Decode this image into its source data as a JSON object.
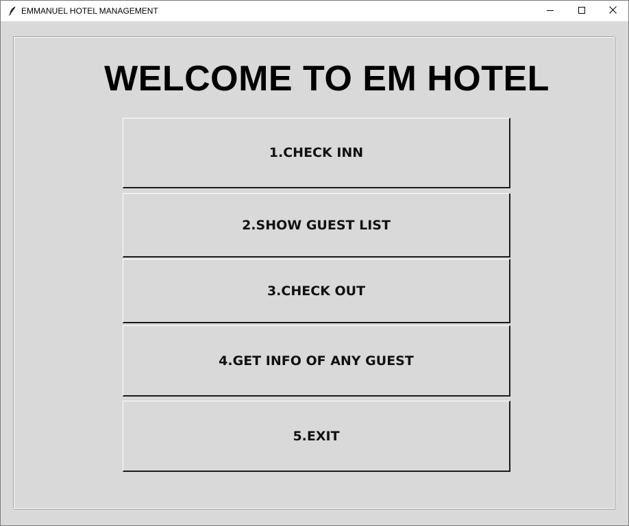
{
  "window": {
    "title": "EMMANUEL HOTEL MANAGEMENT",
    "app_icon": "feather-icon",
    "controls": {
      "minimize": "minimize-icon",
      "maximize": "maximize-icon",
      "close": "close-icon"
    }
  },
  "main": {
    "heading": "WELCOME TO EM HOTEL",
    "buttons": [
      {
        "label": "1.CHECK INN"
      },
      {
        "label": "2.SHOW GUEST LIST"
      },
      {
        "label": "3.CHECK OUT"
      },
      {
        "label": "4.GET INFO OF ANY GUEST"
      },
      {
        "label": "5.EXIT"
      }
    ]
  },
  "colors": {
    "background": "#d9d9d9",
    "titlebar": "#ffffff",
    "text": "#000000"
  }
}
